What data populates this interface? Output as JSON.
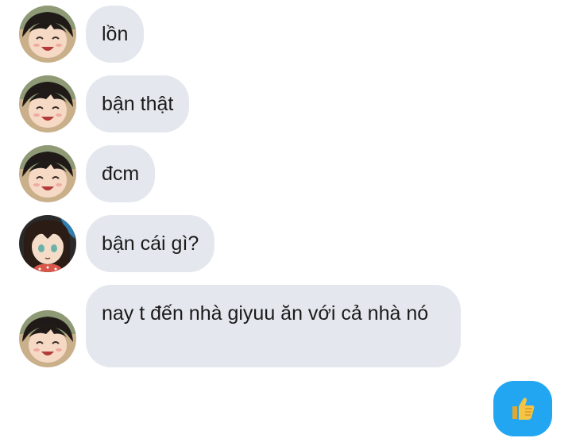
{
  "messages": [
    {
      "sender": "boy",
      "text": "lồn"
    },
    {
      "sender": "boy",
      "text": "bận thật"
    },
    {
      "sender": "boy",
      "text": "đcm"
    },
    {
      "sender": "girl",
      "text": "bận cái gì?"
    },
    {
      "sender": "boy",
      "text": "nay t đến nhà giyuu ăn với cả nhà nó"
    }
  ],
  "reaction": {
    "icon": "thumbs-up-icon",
    "color": "#22a6f2"
  },
  "colors": {
    "bubble_incoming": "#e4e8ee",
    "text": "#1a1a1a",
    "accent": "#22a6f2"
  }
}
